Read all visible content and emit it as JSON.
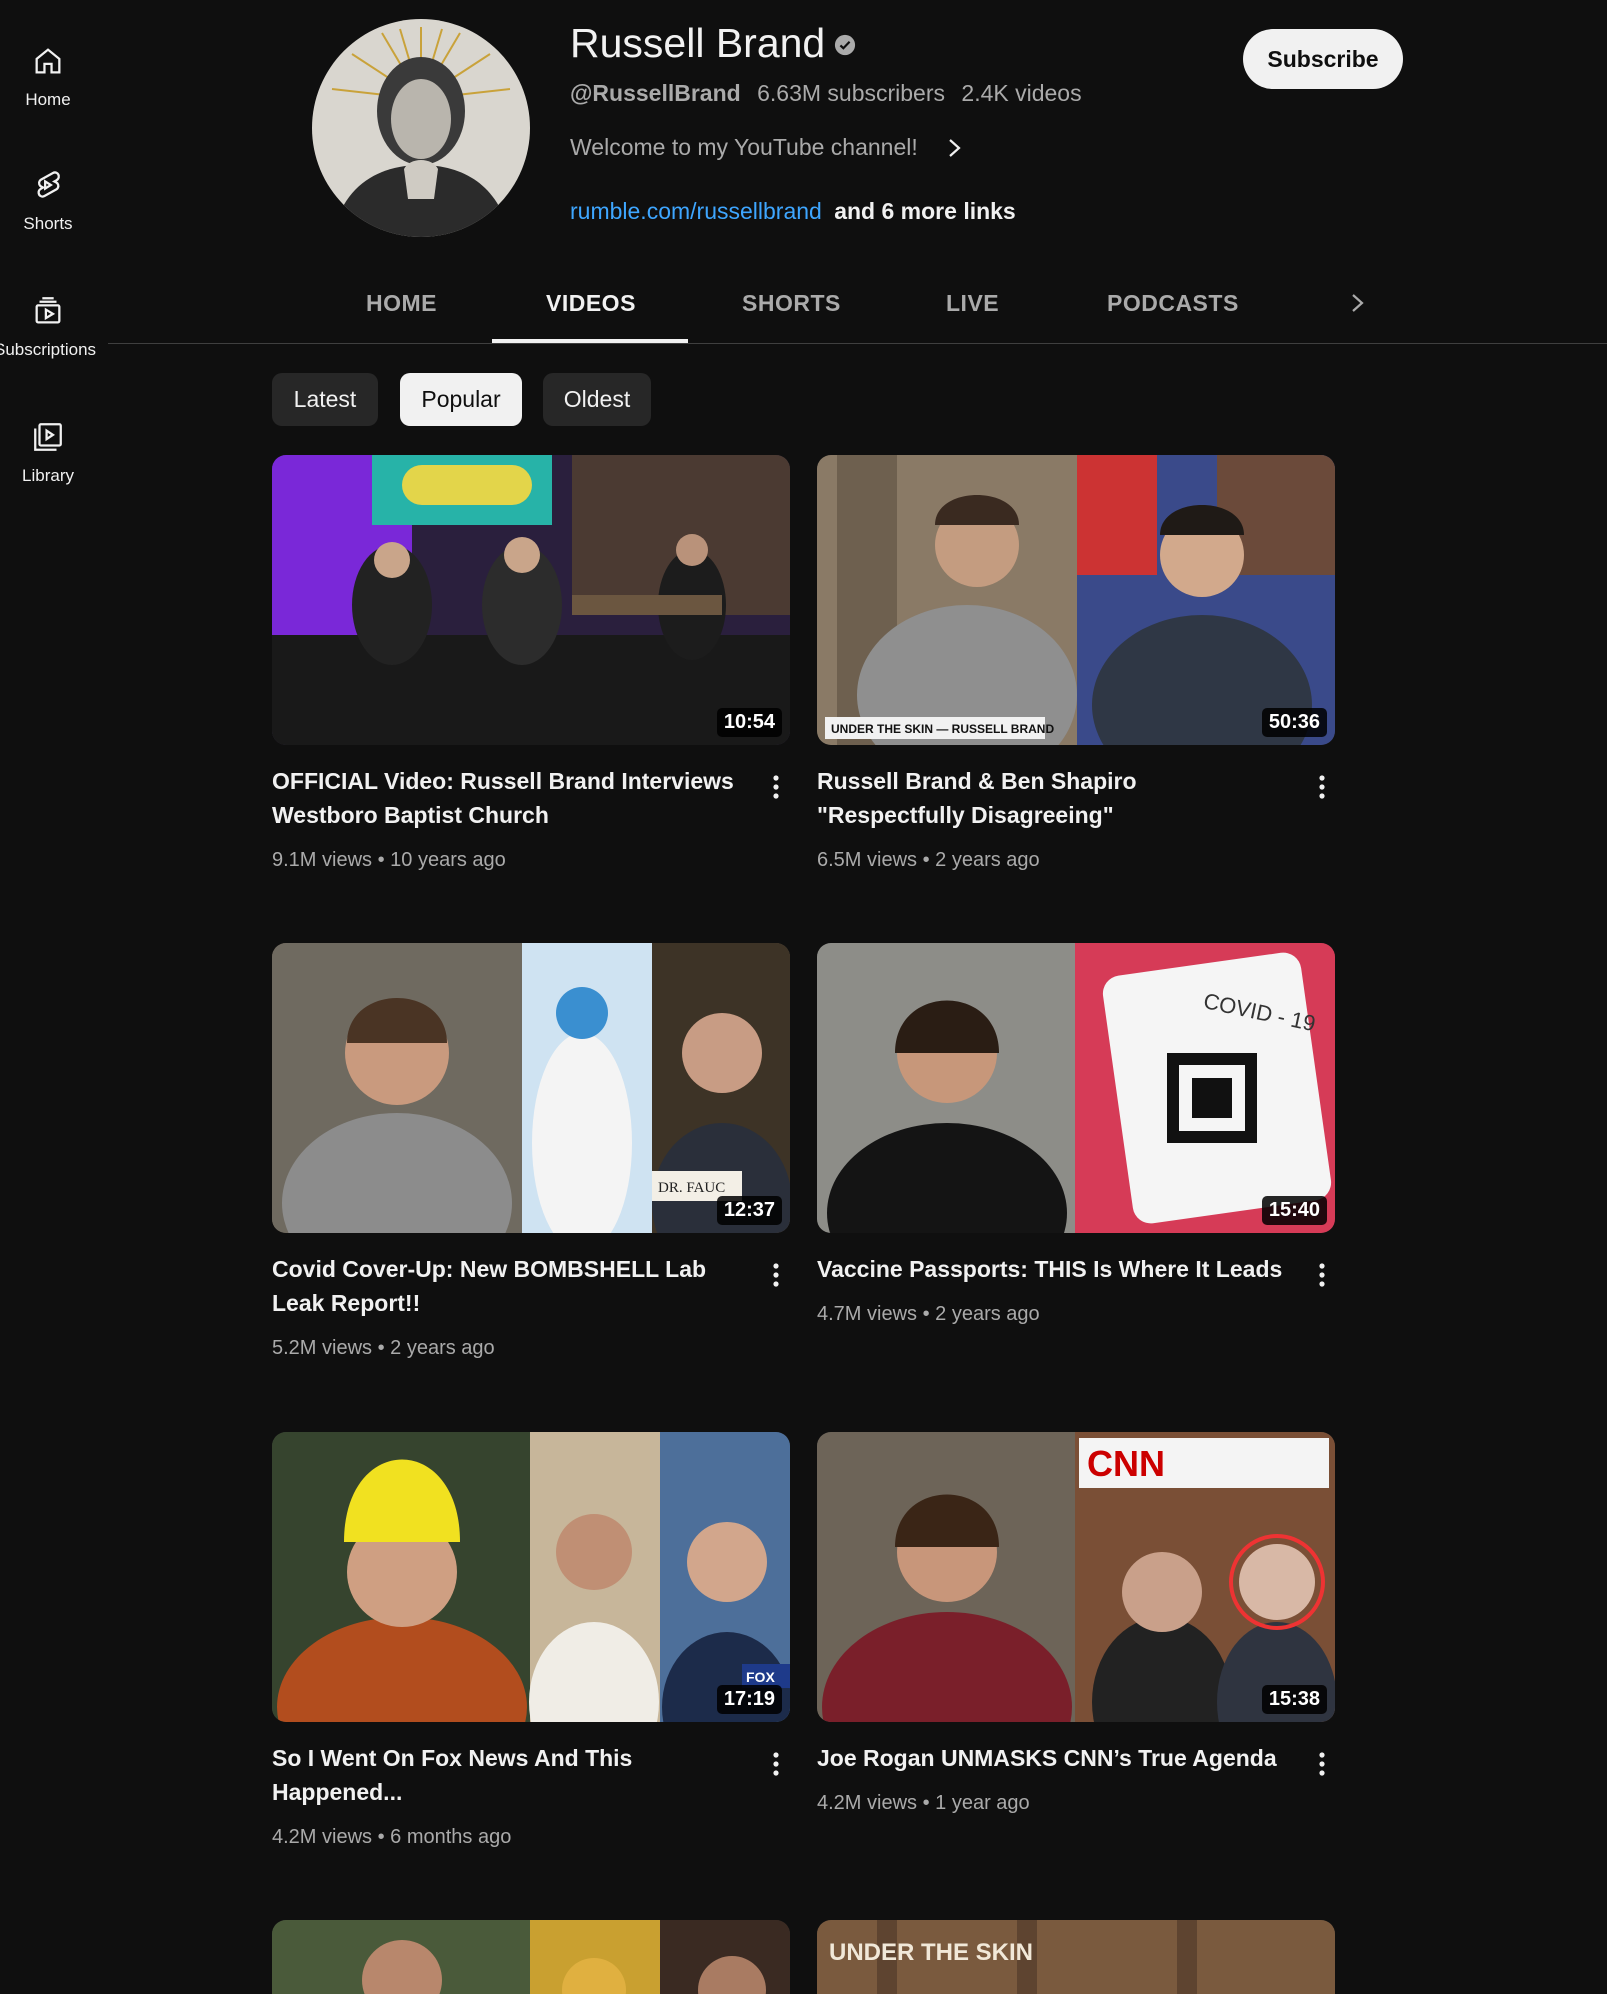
{
  "sidebar": {
    "items": [
      {
        "label": "Home",
        "icon": "home-icon"
      },
      {
        "label": "Shorts",
        "icon": "shorts-icon"
      },
      {
        "label": "Subscriptions",
        "icon": "subscriptions-icon"
      },
      {
        "label": "Library",
        "icon": "library-icon"
      }
    ]
  },
  "channel": {
    "name": "Russell Brand",
    "handle": "@RussellBrand",
    "subscribers": "6.63M subscribers",
    "video_count": "2.4K videos",
    "description": "Welcome to my YouTube channel!",
    "link": "rumble.com/russellbrand",
    "more_links": "and 6 more links",
    "subscribe_label": "Subscribe"
  },
  "tabs": [
    {
      "label": "HOME"
    },
    {
      "label": "VIDEOS"
    },
    {
      "label": "SHORTS"
    },
    {
      "label": "LIVE"
    },
    {
      "label": "PODCASTS"
    }
  ],
  "active_tab": "VIDEOS",
  "chips": [
    {
      "label": "Latest"
    },
    {
      "label": "Popular"
    },
    {
      "label": "Oldest"
    }
  ],
  "active_chip": "Popular",
  "videos": [
    {
      "title": "OFFICIAL Video: Russell Brand Interviews Westboro Baptist Church",
      "views": "9.1M views",
      "age": "10 years ago",
      "duration": "10:54"
    },
    {
      "title": "Russell Brand & Ben Shapiro \"Respectfully Disagreeing\"",
      "views": "6.5M views",
      "age": "2 years ago",
      "duration": "50:36",
      "thumb_caption": "UNDER THE SKIN — RUSSELL BRAND"
    },
    {
      "title": "Covid Cover-Up: New BOMBSHELL Lab Leak Report!!",
      "views": "5.2M views",
      "age": "2 years ago",
      "duration": "12:37",
      "thumb_caption": "DR. FAUC"
    },
    {
      "title": "Vaccine Passports: THIS Is Where It Leads",
      "views": "4.7M views",
      "age": "2 years ago",
      "duration": "15:40",
      "thumb_caption": "COVID - 19"
    },
    {
      "title": "So I Went On Fox News And This Happened...",
      "views": "4.2M views",
      "age": "6 months ago",
      "duration": "17:19",
      "thumb_caption": "FOX"
    },
    {
      "title": "Joe Rogan UNMASKS CNN’s True Agenda",
      "views": "4.2M views",
      "age": "1 year ago",
      "duration": "15:38",
      "thumb_caption": "CNN"
    }
  ],
  "partial_row": [
    {
      "thumb_caption": ""
    },
    {
      "thumb_caption": "UNDER THE SKIN"
    }
  ],
  "colors": {
    "background": "#0f0f0f",
    "text_primary": "#f1f1f1",
    "text_secondary": "#aaaaaa",
    "link": "#3ea6ff",
    "chip_bg": "#272727"
  }
}
